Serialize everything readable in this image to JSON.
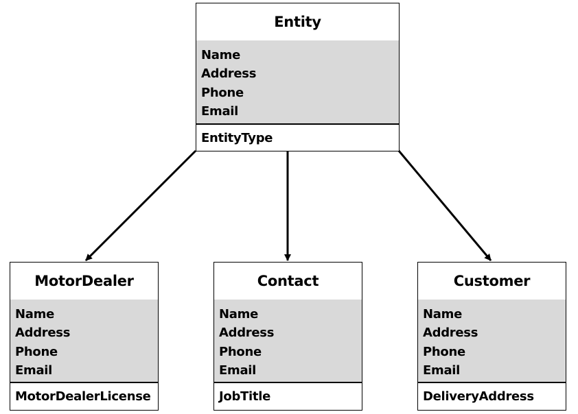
{
  "diagram": {
    "type": "class-inheritance",
    "parent": {
      "name": "Entity",
      "attributes": [
        "Name",
        "Address",
        "Phone",
        "Email"
      ],
      "extra_attribute": "EntityType"
    },
    "children": [
      {
        "name": "MotorDealer",
        "attributes": [
          "Name",
          "Address",
          "Phone",
          "Email"
        ],
        "extra_attribute": "MotorDealerLicense"
      },
      {
        "name": "Contact",
        "attributes": [
          "Name",
          "Address",
          "Phone",
          "Email"
        ],
        "extra_attribute": "JobTitle"
      },
      {
        "name": "Customer",
        "attributes": [
          "Name",
          "Address",
          "Phone",
          "Email"
        ],
        "extra_attribute": "DeliveryAddress"
      }
    ],
    "edges": [
      {
        "from": "Entity",
        "to": "MotorDealer"
      },
      {
        "from": "Entity",
        "to": "Contact"
      },
      {
        "from": "Entity",
        "to": "Customer"
      }
    ],
    "colors": {
      "attribute_fill": "#d9d9d9",
      "border": "#000000",
      "background": "#ffffff"
    }
  }
}
